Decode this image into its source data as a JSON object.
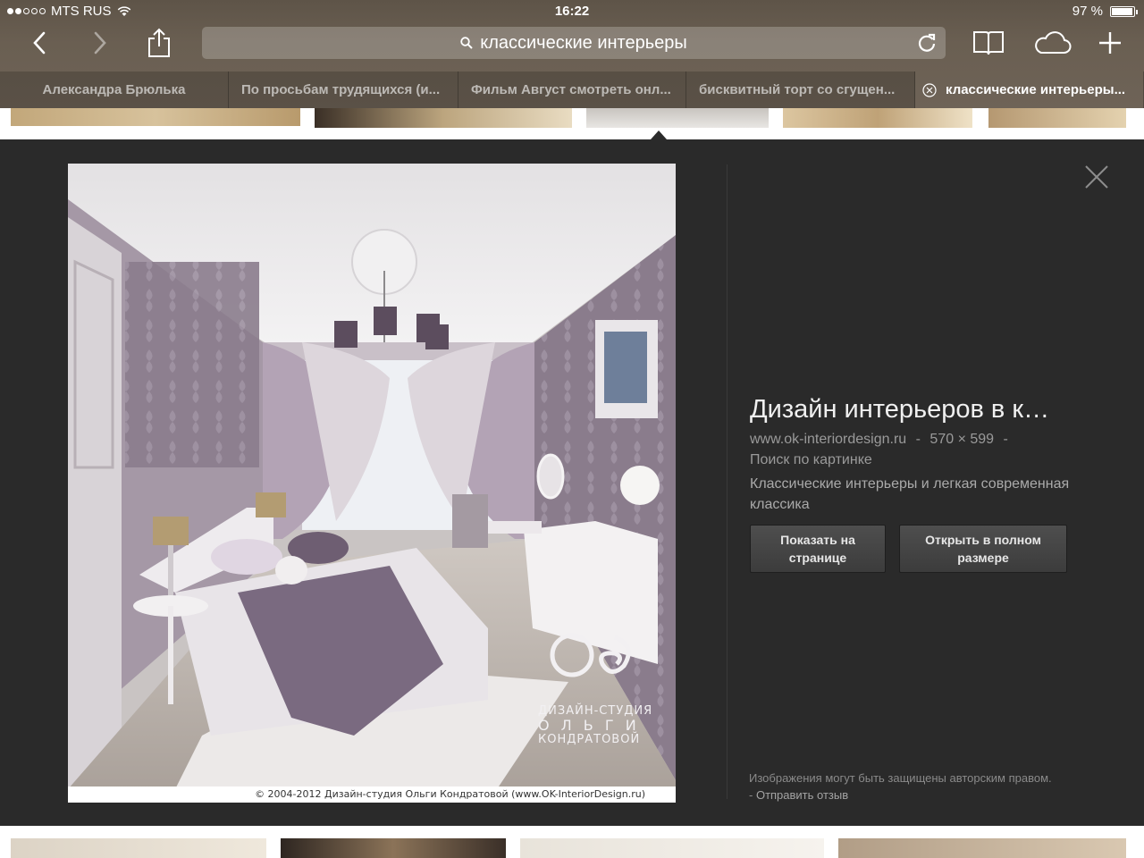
{
  "status_bar": {
    "carrier": "MTS RUS",
    "time": "16:22",
    "battery_text": "97 %",
    "battery_level": 0.97,
    "signal_dots_filled": 2,
    "signal_dots_total": 5
  },
  "toolbar": {
    "url_text": "классические интерьеры",
    "icons": [
      "back-icon",
      "forward-icon",
      "share-icon",
      "search-icon",
      "reload-icon",
      "bookmarks-icon",
      "icloud-tabs-icon",
      "new-tab-icon"
    ]
  },
  "tabs": [
    {
      "label": "Александра Брюлька"
    },
    {
      "label": "По просьбам трудящихся (и..."
    },
    {
      "label": "Фильм Август смотреть онл..."
    },
    {
      "label": "бисквитный торт со сгущен..."
    },
    {
      "label": "классические интерьеры..."
    }
  ],
  "preview": {
    "credit": "© 2004-2012 Дизайн-студия Ольги Кондратовой (www.OK-InteriorDesign.ru)",
    "logo_line1": "ДИЗАЙН-СТУДИЯ",
    "logo_line2": "О Л Ь Г И",
    "logo_line3": "КОНДРАТОВОЙ",
    "title": "Дизайн интерьеров в к…",
    "site": "www.ok-interiordesign.ru",
    "size": "570 × 599",
    "dash": "-",
    "search_by_image": "Поиск по картинке",
    "description": "Классические интерьеры и легкая современная классика",
    "show_on_page_line1": "Показать на",
    "show_on_page_line2": "странице",
    "open_full_line1": "Открыть в полном",
    "open_full_line2": "размере",
    "copyright_text": "Изображения могут быть защищены авторским правом.",
    "feedback_link": "Отправить отзыв"
  },
  "colors": {
    "chrome": "#6a5f52",
    "panel": "#2a2a2a",
    "wall": "#8f8190",
    "curtain": "#b6a6b8",
    "floor": "#b4aca6"
  }
}
